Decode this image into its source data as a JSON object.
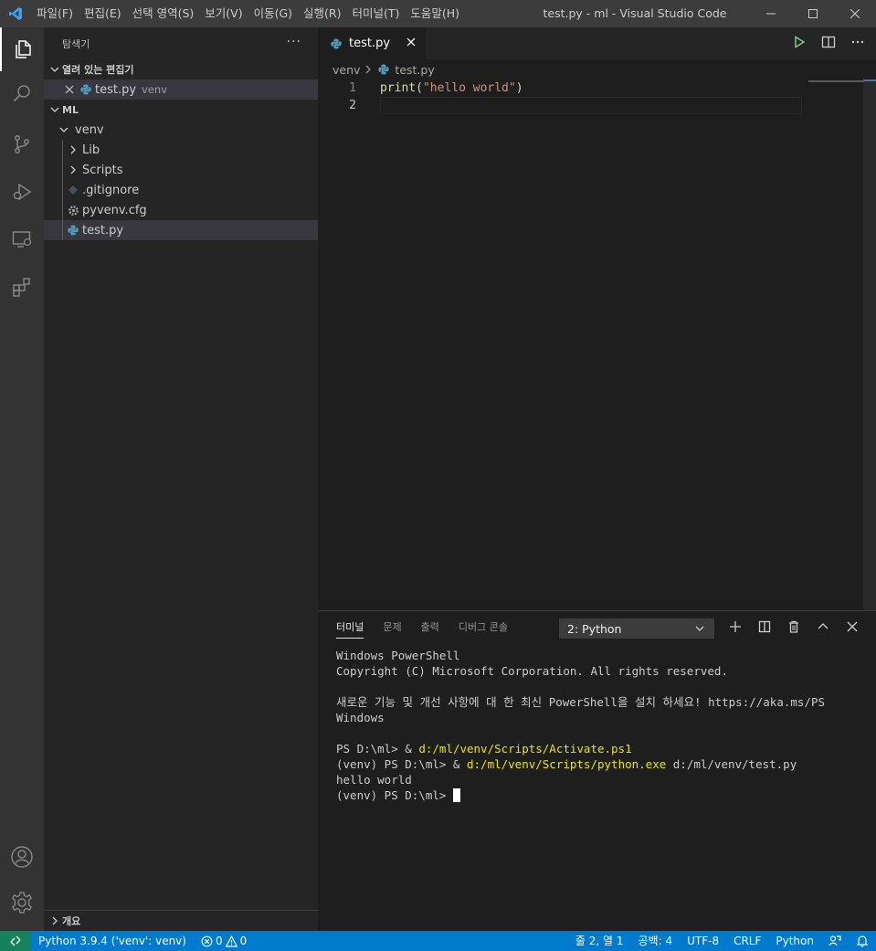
{
  "titlebar": {
    "menus": [
      "파일(F)",
      "편집(E)",
      "선택 영역(S)",
      "보기(V)",
      "이동(G)",
      "실행(R)",
      "터미널(T)",
      "도움말(H)"
    ],
    "window_title": "test.py - ml - Visual Studio Code"
  },
  "sidebar": {
    "title": "탐색기",
    "more": "···",
    "open_editors": {
      "header": "열려 있는 편집기",
      "items": [
        {
          "name": "test.py",
          "desc": "venv"
        }
      ]
    },
    "workspace": {
      "header": "ML",
      "tree": [
        {
          "label": "venv"
        },
        {
          "label": "Lib"
        },
        {
          "label": "Scripts"
        },
        {
          "label": ".gitignore"
        },
        {
          "label": "pyvenv.cfg"
        },
        {
          "label": "test.py"
        }
      ]
    },
    "outline_header": "개요"
  },
  "editor": {
    "tab_label": "test.py",
    "breadcrumb": [
      "venv",
      "test.py"
    ],
    "lines": [
      {
        "num": "1",
        "fn": "print",
        "open": "(",
        "str": "\"hello world\"",
        "close": ")"
      },
      {
        "num": "2"
      }
    ]
  },
  "panel": {
    "tabs": [
      "터미널",
      "문제",
      "출력",
      "디버그 콘솔"
    ],
    "terminal_select": "2: Python",
    "terminal": {
      "l1": "Windows PowerShell",
      "l2": "Copyright (C) Microsoft Corporation. All rights reserved.",
      "l3": "새로운 기능 및 개선 사항에 대 한 최신 PowerShell을 설치 하세요! https://aka.ms/PS",
      "l4": "Windows",
      "l5_prompt": "PS D:\\ml> & ",
      "l5_cmd": "d:/ml/venv/Scripts/Activate.ps1",
      "l6_prompt": "(venv) PS D:\\ml> & ",
      "l6_cmd": "d:/ml/venv/Scripts/python.exe",
      "l6_arg": " d:/ml/venv/test.py",
      "l7": "hello world",
      "l8_prompt": "(venv) PS D:\\ml> "
    }
  },
  "statusbar": {
    "python": "Python 3.9.4  ('venv': venv)",
    "errors": "0",
    "warnings": "0",
    "position": "줄 2, 열 1",
    "spaces": "공백: 4",
    "encoding": "UTF-8",
    "eol": "CRLF",
    "language": "Python"
  },
  "colors": {
    "statusbar": "#007acc",
    "remote": "#16825d",
    "activitybar": "#333333",
    "sidebar": "#252526",
    "editor": "#1e1e1e",
    "python_icon": "#519aba"
  }
}
